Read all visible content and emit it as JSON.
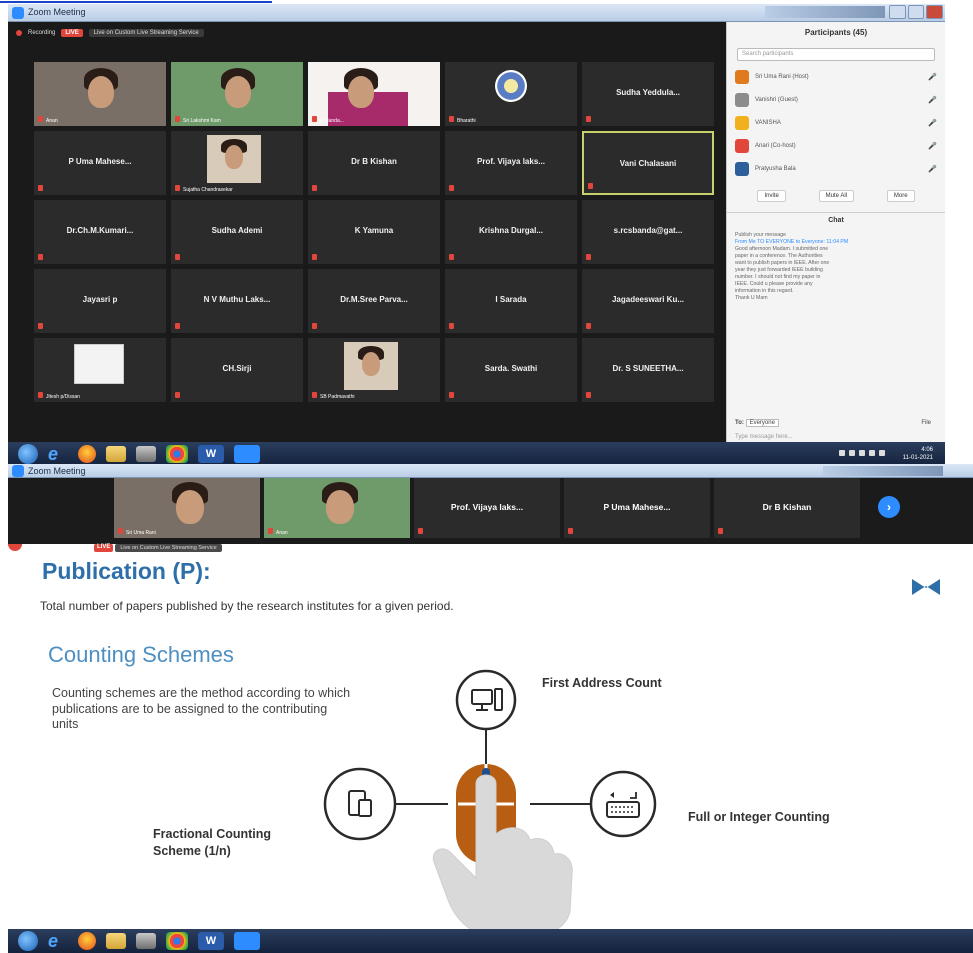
{
  "top_link": {
    "color": "#1a45c9"
  },
  "window": {
    "title": "Zoom Meeting"
  },
  "recording": {
    "label": "Recording",
    "live": "LIVE",
    "live_on": "Live on Custom Live Streaming Service"
  },
  "gallery": [
    {
      "name": "",
      "label": "Anan",
      "video": true
    },
    {
      "name": "",
      "label": "Sri Lakshmi Kam",
      "video": true
    },
    {
      "name": "",
      "label": "R Nanda...",
      "video": true
    },
    {
      "name": "",
      "label": "Bharathi",
      "video": true,
      "logo": true
    },
    {
      "name": "Sudha Yeddula...",
      "label": "",
      "video": false
    },
    {
      "name": "P Uma Mahese...",
      "label": "",
      "video": false
    },
    {
      "name": "",
      "label": "Sujatha Chandrasekar",
      "video": true,
      "photo": true
    },
    {
      "name": "Dr B Kishan",
      "label": "",
      "video": false
    },
    {
      "name": "Prof. Vijaya laks...",
      "label": "",
      "video": false
    },
    {
      "name": "Vani Chalasani",
      "label": "",
      "video": false,
      "active": true
    },
    {
      "name": "Dr.Ch.M.Kumari...",
      "label": "",
      "video": false
    },
    {
      "name": "Sudha Ademi",
      "label": "",
      "video": false
    },
    {
      "name": "K Yamuna",
      "label": "",
      "video": false
    },
    {
      "name": "Krishna Durgal...",
      "label": "",
      "video": false
    },
    {
      "name": "s.rcsbanda@gat...",
      "label": "",
      "video": false
    },
    {
      "name": "Jayasri p",
      "label": "",
      "video": false
    },
    {
      "name": "N V Muthu Laks...",
      "label": "",
      "video": false
    },
    {
      "name": "Dr.M.Sree Parva...",
      "label": "",
      "video": false
    },
    {
      "name": "I Sarada",
      "label": "",
      "video": false
    },
    {
      "name": "Jagadeeswari Ku...",
      "label": "",
      "video": false
    },
    {
      "name": "",
      "label": "Jitesh p/Dissan",
      "video": true,
      "doc": true
    },
    {
      "name": "CH.Sirji",
      "label": "",
      "video": false
    },
    {
      "name": "",
      "label": "SB Padmavathi",
      "video": true,
      "photo": true
    },
    {
      "name": "Sarda. Swathi",
      "label": "",
      "video": false
    },
    {
      "name": "Dr. S SUNEETHA...",
      "label": "",
      "video": false
    }
  ],
  "participants": {
    "header": "Participants (45)",
    "search_placeholder": "Search participants",
    "rows": [
      {
        "name": "Sri Uma Rani (Host)",
        "color": "#e07a1e"
      },
      {
        "name": "Vanishri (Guest)",
        "color": "#8c8c8c"
      },
      {
        "name": "VANISHA",
        "color": "#f2b01e"
      },
      {
        "name": "Anari (Co-host)",
        "color": "#e0463a"
      },
      {
        "name": "Pratyusha Bala",
        "color": "#2d5f9a"
      }
    ],
    "buttons": [
      "Invite",
      "Mute All",
      "More"
    ]
  },
  "chat": {
    "header": "Chat",
    "lines": [
      "Publish your message",
      "From Me TO EVERYONE to Everyone:  11:04 PM",
      "Good afternoon Madam. I submitted one",
      "paper in a conference. The Authorities",
      "want to publish papers in IEEE. After one",
      "year they just forwarded IEEE building",
      "number. I should not find my paper in",
      "IEEE. Could u please provide any",
      "information in this regard.",
      "Thank U Mam"
    ],
    "to_label": "To:",
    "to_value": "Everyone",
    "file_label": "File",
    "input_placeholder": "Type message here..."
  },
  "taskbar": {
    "time": "4:06",
    "date": "11-01-2021",
    "word_label": "W"
  },
  "strip_tiles": [
    {
      "name": "",
      "label": "Sri Uma Rani",
      "video": true
    },
    {
      "name": "",
      "label": "Anan",
      "video": true
    },
    {
      "name": "Prof. Vijaya laks...",
      "label": "",
      "video": false
    },
    {
      "name": "P Uma Mahese...",
      "label": "",
      "video": false
    },
    {
      "name": "Dr B Kishan",
      "label": "",
      "video": false
    }
  ],
  "strip_next": "›",
  "slide": {
    "live": "LIVE",
    "live_on": "Live on Custom Live Streaming Service",
    "title": "Publication (P):",
    "definition": "Total number of papers published by the research institutes for a given period.",
    "subtitle": "Counting Schemes",
    "body": "Counting schemes are the method according to which publications are to be assigned to the contributing units",
    "label_first": "First Address Count",
    "label_full": "Full or Integer Counting",
    "label_frac_1": "Fractional Counting",
    "label_frac_2": "Scheme (1/n)"
  },
  "colors": {
    "accent": "#2d8cff",
    "slide_title": "#2f6fa9",
    "slide_sub": "#4e8fc2",
    "mouse": "#b75e12",
    "live_red": "#e0463a"
  }
}
